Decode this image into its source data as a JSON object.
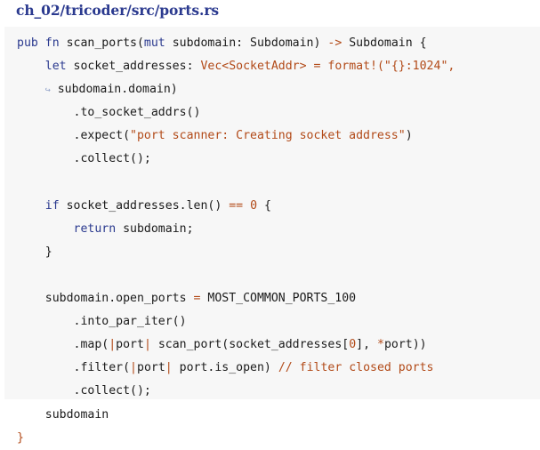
{
  "file_title": "ch_02/tricoder/src/ports.rs",
  "code": {
    "l1": {
      "t1": "pub fn",
      "t2": " scan_ports(",
      "t3": "mut",
      "t4": " subdomain: Subdomain) ",
      "t5": "->",
      "t6": " Subdomain {"
    },
    "l2": {
      "t1": "    ",
      "t2": "let",
      "t3": " socket_addresses: ",
      "t4": "Vec<SocketAddr>",
      "t5": " ",
      "t6": "=",
      "t7": " ",
      "t8": "format!(\"{}:1024\",",
      "wrap": "↪"
    },
    "l3": {
      "t1": " subdomain.domain)"
    },
    "l4": {
      "t1": "        .to_socket_addrs()"
    },
    "l5": {
      "t1": "        .expect(",
      "t2": "\"port scanner: Creating socket address\"",
      "t3": ")"
    },
    "l6": {
      "t1": "        .collect();"
    },
    "l7": {
      "t1": ""
    },
    "l8": {
      "t1": "    ",
      "t2": "if",
      "t3": " socket_addresses.len() ",
      "t4": "==",
      "t5": " ",
      "t6": "0",
      "t7": " {"
    },
    "l9": {
      "t1": "        ",
      "t2": "return",
      "t3": " subdomain;"
    },
    "l10": {
      "t1": "    }"
    },
    "l11": {
      "t1": ""
    },
    "l12": {
      "t1": "    subdomain.open_ports ",
      "t2": "=",
      "t3": " MOST_COMMON_PORTS_100"
    },
    "l13": {
      "t1": "        .into_par_iter()"
    },
    "l14": {
      "t1": "        .map(",
      "t2": "|",
      "t3": "port",
      "t4": "|",
      "t5": " scan_port(socket_addresses[",
      "t6": "0",
      "t7": "], ",
      "t8": "*",
      "t9": "port))"
    },
    "l15": {
      "t1": "        .filter(",
      "t2": "|",
      "t3": "port",
      "t4": "|",
      "t5": " port.is_open) ",
      "t6": "// filter closed ports"
    },
    "l16": {
      "t1": "        .collect();"
    },
    "l17": {
      "t1": "    subdomain"
    },
    "l18": {
      "t1": "}"
    }
  }
}
